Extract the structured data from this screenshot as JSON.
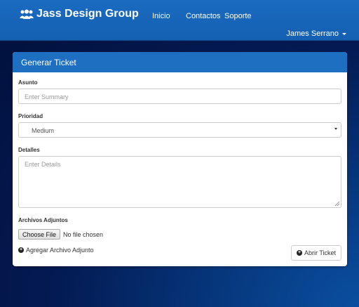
{
  "navbar": {
    "brand": "Jass Design Group",
    "links": [
      "Inicio",
      "Contactos",
      "Soporte"
    ],
    "user": "James Serrano"
  },
  "form": {
    "title": "Generar Ticket",
    "summary_label": "Asunto",
    "summary_placeholder": "Enter Summary",
    "priority_label": "Prioridad",
    "priority_value": "Medium",
    "details_label": "Detalles",
    "details_placeholder": "Enter Details",
    "attachments_label": "Archivos Adjuntos",
    "choose_file": "Choose File",
    "no_file": "No file chosen",
    "add_attachment": "Agregar Archivo Adjunto",
    "submit": "Abrir Ticket"
  },
  "colors": {
    "navbar": "#1a6bc0",
    "panel_heading": "#1e6fc2"
  },
  "icons": {
    "brand": "users-icon",
    "add": "plus-circle-icon",
    "submit": "plus-circle-icon"
  }
}
